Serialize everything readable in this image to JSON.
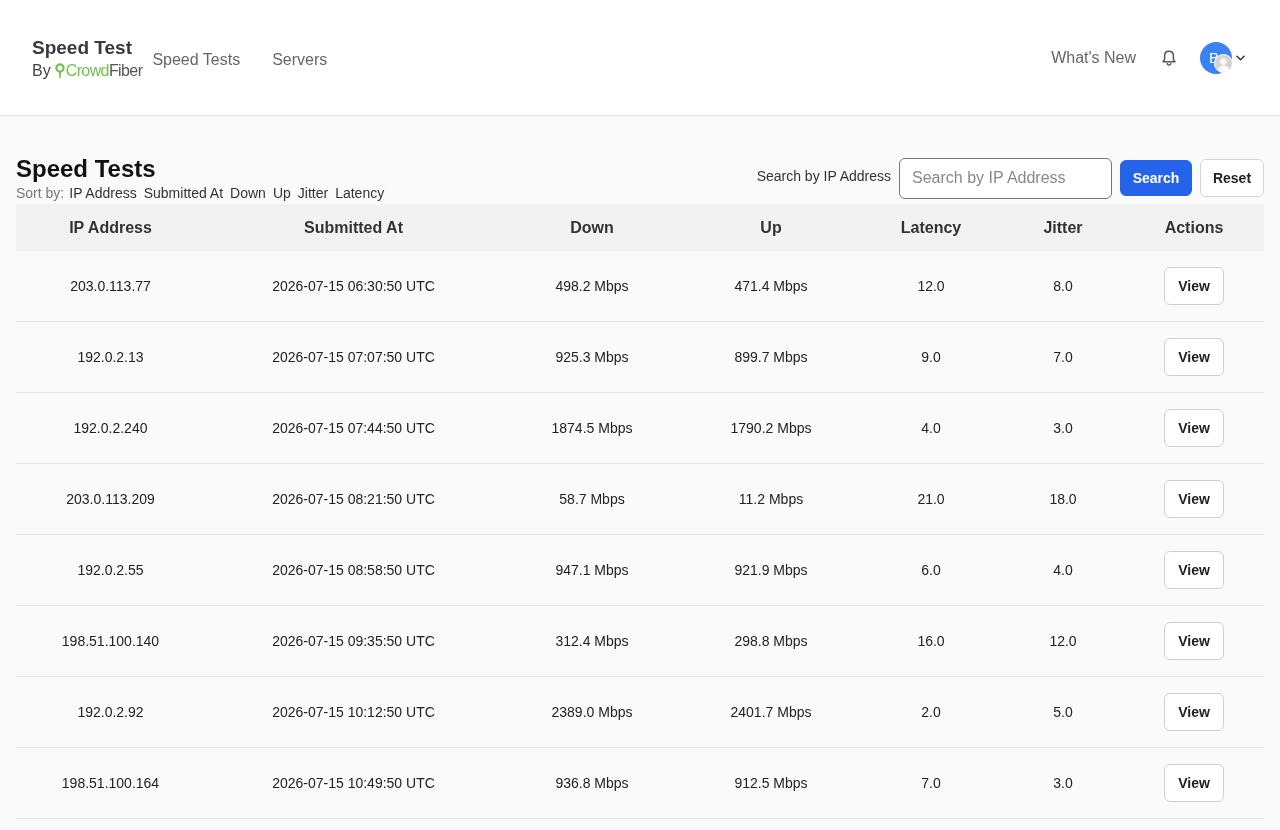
{
  "header": {
    "app_title": "Speed Test",
    "byline": "By",
    "logo": {
      "primary": "Crowd",
      "secondary": "Fiber"
    },
    "nav": [
      {
        "label": "Speed Tests"
      },
      {
        "label": "Servers"
      }
    ],
    "whats_new": "What's New",
    "avatar_initial": "B"
  },
  "page": {
    "title": "Speed Tests",
    "sort_label": "Sort by:",
    "sort_options": [
      "IP Address",
      "Submitted At",
      "Down",
      "Up",
      "Jitter",
      "Latency"
    ],
    "search": {
      "label": "Search by IP Address",
      "placeholder": "Search by IP Address"
    },
    "search_button": "Search",
    "reset_button": "Reset"
  },
  "table": {
    "columns": [
      "IP Address",
      "Submitted At",
      "Down",
      "Up",
      "Latency",
      "Jitter",
      "Actions"
    ],
    "rows": [
      {
        "cells": [
          "203.0.113.77",
          "2026-07-15 06:30:50 UTC",
          "498.2 Mbps",
          "471.4 Mbps",
          "12.0",
          "8.0"
        ],
        "action": "View"
      },
      {
        "cells": [
          "192.0.2.13",
          "2026-07-15 07:07:50 UTC",
          "925.3 Mbps",
          "899.7 Mbps",
          "9.0",
          "7.0"
        ],
        "action": "View"
      },
      {
        "cells": [
          "192.0.2.240",
          "2026-07-15 07:44:50 UTC",
          "1874.5 Mbps",
          "1790.2 Mbps",
          "4.0",
          "3.0"
        ],
        "action": "View"
      },
      {
        "cells": [
          "203.0.113.209",
          "2026-07-15 08:21:50 UTC",
          "58.7 Mbps",
          "11.2 Mbps",
          "21.0",
          "18.0"
        ],
        "action": "View"
      },
      {
        "cells": [
          "192.0.2.55",
          "2026-07-15 08:58:50 UTC",
          "947.1 Mbps",
          "921.9 Mbps",
          "6.0",
          "4.0"
        ],
        "action": "View"
      },
      {
        "cells": [
          "198.51.100.140",
          "2026-07-15 09:35:50 UTC",
          "312.4 Mbps",
          "298.8 Mbps",
          "16.0",
          "12.0"
        ],
        "action": "View"
      },
      {
        "cells": [
          "192.0.2.92",
          "2026-07-15 10:12:50 UTC",
          "2389.0 Mbps",
          "2401.7 Mbps",
          "2.0",
          "5.0"
        ],
        "action": "View"
      },
      {
        "cells": [
          "198.51.100.164",
          "2026-07-15 10:49:50 UTC",
          "936.8 Mbps",
          "912.5 Mbps",
          "7.0",
          "3.0"
        ],
        "action": "View"
      }
    ]
  }
}
